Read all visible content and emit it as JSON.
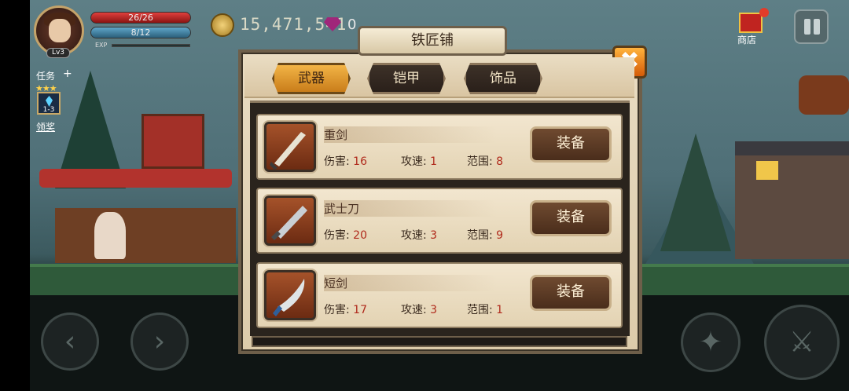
{
  "hud": {
    "level": "Lv3",
    "hp": "26/26",
    "mp": "8/12",
    "exp_label": "EXP",
    "gold": "15,471,541",
    "gems": "0",
    "quest_label": "任务",
    "quest_plus": "+",
    "quest_stars": "★★★",
    "quest_stage": "1-3",
    "reward_label": "领奖",
    "shop_label": "商店"
  },
  "panel": {
    "title": "铁匠铺",
    "close": "✖",
    "tabs": [
      {
        "label": "武器",
        "active": true
      },
      {
        "label": "铠甲",
        "active": false
      },
      {
        "label": "饰品",
        "active": false
      }
    ],
    "items": [
      {
        "name": "重剑",
        "dmg_label": "伤害:",
        "dmg": "16",
        "spd_label": "攻速:",
        "spd": "1",
        "rng_label": "范围:",
        "rng": "8",
        "button": "装备"
      },
      {
        "name": "武士刀",
        "dmg_label": "伤害:",
        "dmg": "20",
        "spd_label": "攻速:",
        "spd": "3",
        "rng_label": "范围:",
        "rng": "9",
        "button": "装备"
      },
      {
        "name": "短剑",
        "dmg_label": "伤害:",
        "dmg": "17",
        "spd_label": "攻速:",
        "spd": "3",
        "rng_label": "范围:",
        "rng": "1",
        "button": "装备"
      }
    ]
  },
  "icons": [
    "avatar",
    "coin-icon",
    "gem-icon",
    "quest-crystal-icon",
    "shop-gift-icon",
    "pause-icon",
    "sword-icon",
    "katana-icon",
    "dagger-icon",
    "joystick-left",
    "joystick-right",
    "skill-icon",
    "attack-icon"
  ]
}
